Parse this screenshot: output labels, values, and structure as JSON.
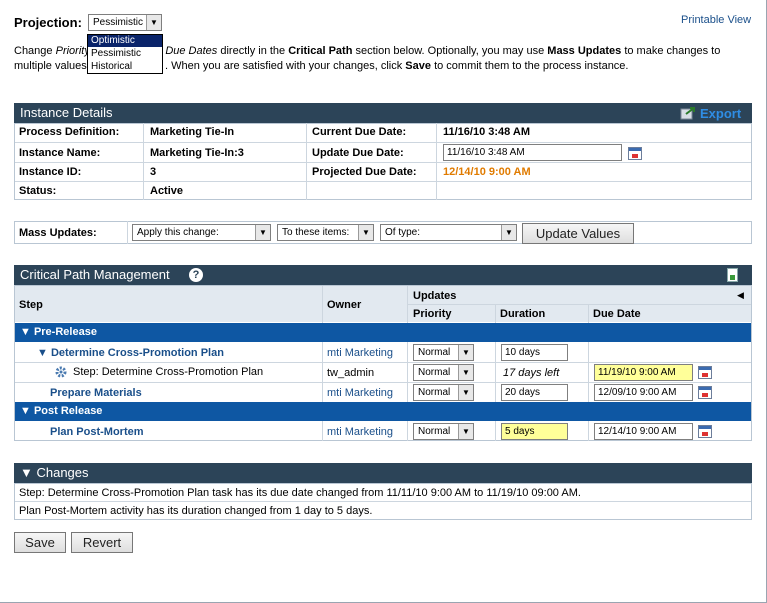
{
  "projection": {
    "label": "Projection:",
    "selected": "Pessimistic",
    "options": [
      "Optimistic",
      "Pessimistic",
      "Historical"
    ]
  },
  "printable_view": "Printable View",
  "intro": {
    "p1": "Change",
    "p2": "Priority",
    "p3": "nd",
    "p4": "Due Dates",
    "p5": "directly in the",
    "p6": "Critical Path",
    "p7": "section below. Optionally, you may use",
    "p8": "Mass Updates",
    "p9": "to make changes to",
    "l2a": "multiple values",
    "l2b": ". When you are satisfied with your changes, click",
    "l2c": "Save",
    "l2d": "to commit them to the process instance."
  },
  "instance_details": {
    "title": "Instance Details",
    "export": "Export",
    "process_definition_label": "Process Definition:",
    "process_definition": "Marketing Tie-In",
    "instance_name_label": "Instance Name:",
    "instance_name": "Marketing Tie-In:3",
    "instance_id_label": "Instance ID:",
    "instance_id": "3",
    "status_label": "Status:",
    "status": "Active",
    "current_due_label": "Current Due Date:",
    "current_due": "11/16/10 3:48 AM",
    "update_due_label": "Update Due Date:",
    "update_due": "11/16/10 3:48 AM",
    "projected_due_label": "Projected Due Date:",
    "projected_due": "12/14/10 9:00 AM",
    "projected_color": "#e07b00"
  },
  "mass_updates": {
    "label": "Mass Updates:",
    "change": "Apply this change:",
    "items": "To these items:",
    "type": "Of type:",
    "button": "Update Values"
  },
  "critical_path": {
    "title": "Critical Path Management",
    "help": "?",
    "col_step": "Step",
    "col_owner": "Owner",
    "col_updates": "Updates",
    "col_priority": "Priority",
    "col_duration": "Duration",
    "col_due": "Due Date",
    "group1": "▼ Pre-Release",
    "group2": "▼ Post Release",
    "rows": [
      {
        "step": "▼ Determine Cross-Promotion Plan",
        "owner": "mti Marketing",
        "priority": "Normal",
        "duration": "10 days",
        "due": ""
      },
      {
        "step": "Step: Determine Cross-Promotion Plan",
        "owner": "tw_admin",
        "priority": "Normal",
        "duration": "17 days left",
        "due": "11/19/10 9:00 AM"
      },
      {
        "step": "Prepare Materials",
        "owner": "mti Marketing",
        "priority": "Normal",
        "duration": "20 days",
        "due": "12/09/10 9:00 AM"
      },
      {
        "step": "Plan Post-Mortem",
        "owner": "mti Marketing",
        "priority": "Normal",
        "duration": "5 days",
        "due": "12/14/10 9:00 AM"
      }
    ]
  },
  "changes": {
    "title": "▼ Changes",
    "items": [
      "Step: Determine Cross-Promotion Plan task has its due date changed from 11/11/10 9:00 AM to 11/19/10 09:00 AM.",
      "Plan Post-Mortem activity has its duration changed from 1 day to 5 days."
    ]
  },
  "actions": {
    "save": "Save",
    "revert": "Revert"
  },
  "colors": {
    "header": "#2c4458",
    "group": "#0e57a3",
    "highlight": "#ffff99"
  }
}
